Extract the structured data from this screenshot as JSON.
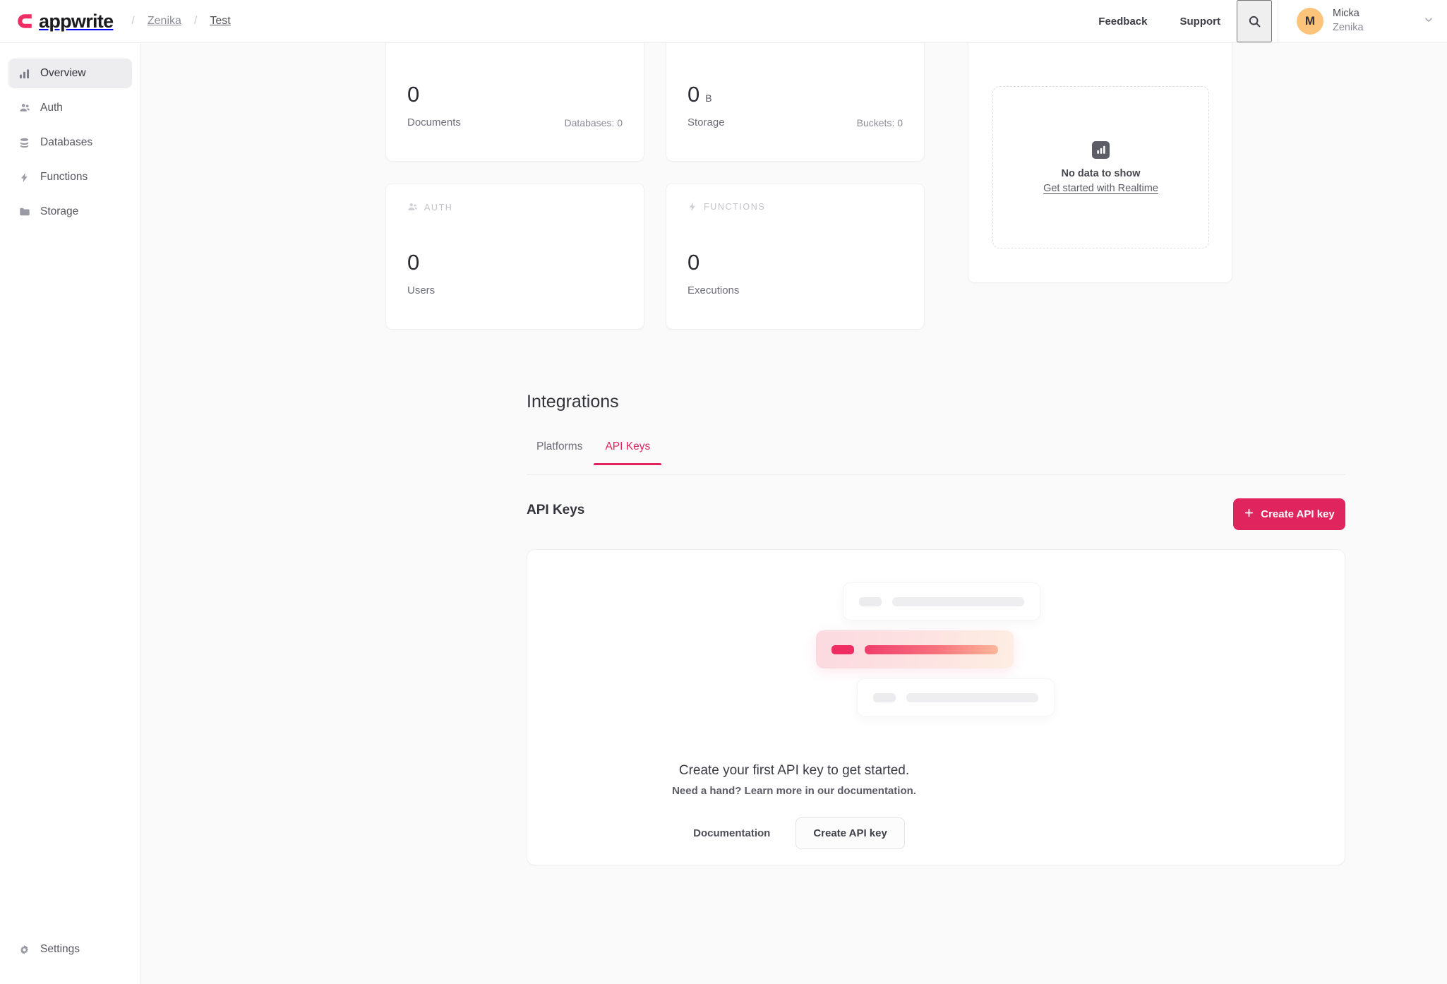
{
  "header": {
    "brand": "appwrite",
    "logo_color": "#F02E65",
    "breadcrumbs": [
      "Zenika",
      "Test"
    ],
    "separator": "/",
    "links": [
      {
        "label": "Feedback",
        "name": "feedback-link"
      },
      {
        "label": "Support",
        "name": "support-link"
      }
    ],
    "search_icon": "search-icon",
    "user": {
      "initial": "M",
      "name": "Micka",
      "org": "Zenika",
      "avatar_color": "#FCC47B"
    }
  },
  "sidebar": {
    "items": [
      {
        "label": "Overview",
        "icon": "bar-chart-icon",
        "active": true
      },
      {
        "label": "Auth",
        "icon": "users-icon",
        "active": false
      },
      {
        "label": "Databases",
        "icon": "database-icon",
        "active": false
      },
      {
        "label": "Functions",
        "icon": "lightning-icon",
        "active": false
      },
      {
        "label": "Storage",
        "icon": "folder-icon",
        "active": false
      }
    ],
    "settings": {
      "label": "Settings",
      "icon": "gear-icon"
    }
  },
  "metrics": [
    {
      "head": null,
      "head_icon": null,
      "value": "0",
      "unit": null,
      "label": "Documents",
      "sub": "Databases: 0"
    },
    {
      "head": null,
      "head_icon": null,
      "value": "0",
      "unit": "B",
      "label": "Storage",
      "sub": "Buckets: 0"
    },
    {
      "head": "AUTH",
      "head_icon": "users-icon",
      "value": "0",
      "unit": null,
      "label": "Users",
      "sub": null
    },
    {
      "head": "FUNCTIONS",
      "head_icon": "lightning-icon",
      "value": "0",
      "unit": null,
      "label": "Executions",
      "sub": null
    }
  ],
  "realtime": {
    "icon": "bar-chart-icon",
    "title": "No data to show",
    "link": "Get started with Realtime"
  },
  "integrations": {
    "title": "Integrations",
    "tabs": [
      {
        "label": "Platforms",
        "active": false
      },
      {
        "label": "API Keys",
        "active": true
      }
    ],
    "accent_color": "#E0245E",
    "section_title": "API Keys",
    "create_button": {
      "label": "Create API key",
      "icon": "plus-icon"
    },
    "empty_state": {
      "title": "Create your first API key to get started.",
      "subtitle": "Need a hand? Learn more in our documentation.",
      "doc_button": "Documentation",
      "create_button": "Create API key"
    }
  }
}
